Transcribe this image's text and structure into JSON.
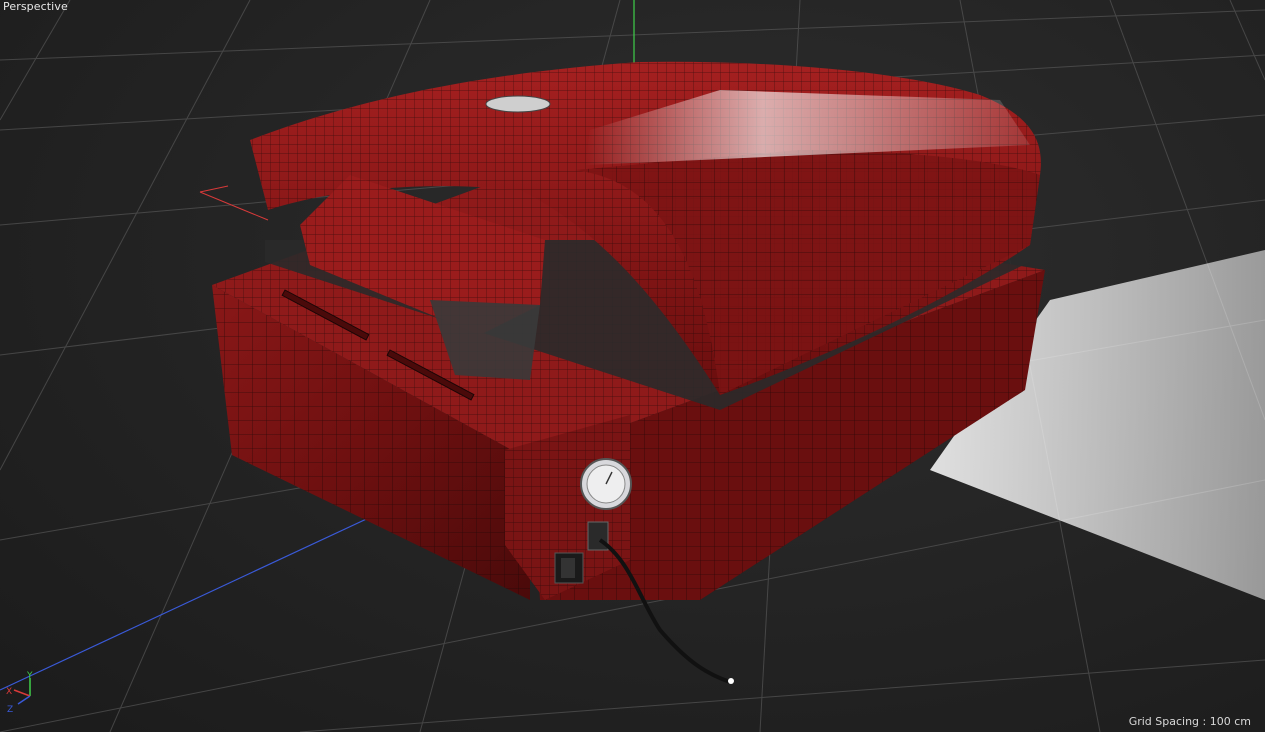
{
  "viewport": {
    "view_name": "Perspective",
    "grid_spacing_label": "Grid Spacing : 100 cm"
  },
  "axis_gizmo": {
    "x_label": "X",
    "y_label": "Y",
    "z_label": "Z",
    "x_color": "#d83a3a",
    "y_color": "#3fd04a",
    "z_color": "#3a5ad8"
  },
  "scene": {
    "object_name": "heat-press-machine",
    "object_color": "#7a1414",
    "wireframe_color": "#1a0a0a",
    "floor_grid_color": "#5a5a5a",
    "icons": [
      "pressure-gauge-icon",
      "power-switch-icon",
      "cable-icon"
    ]
  }
}
